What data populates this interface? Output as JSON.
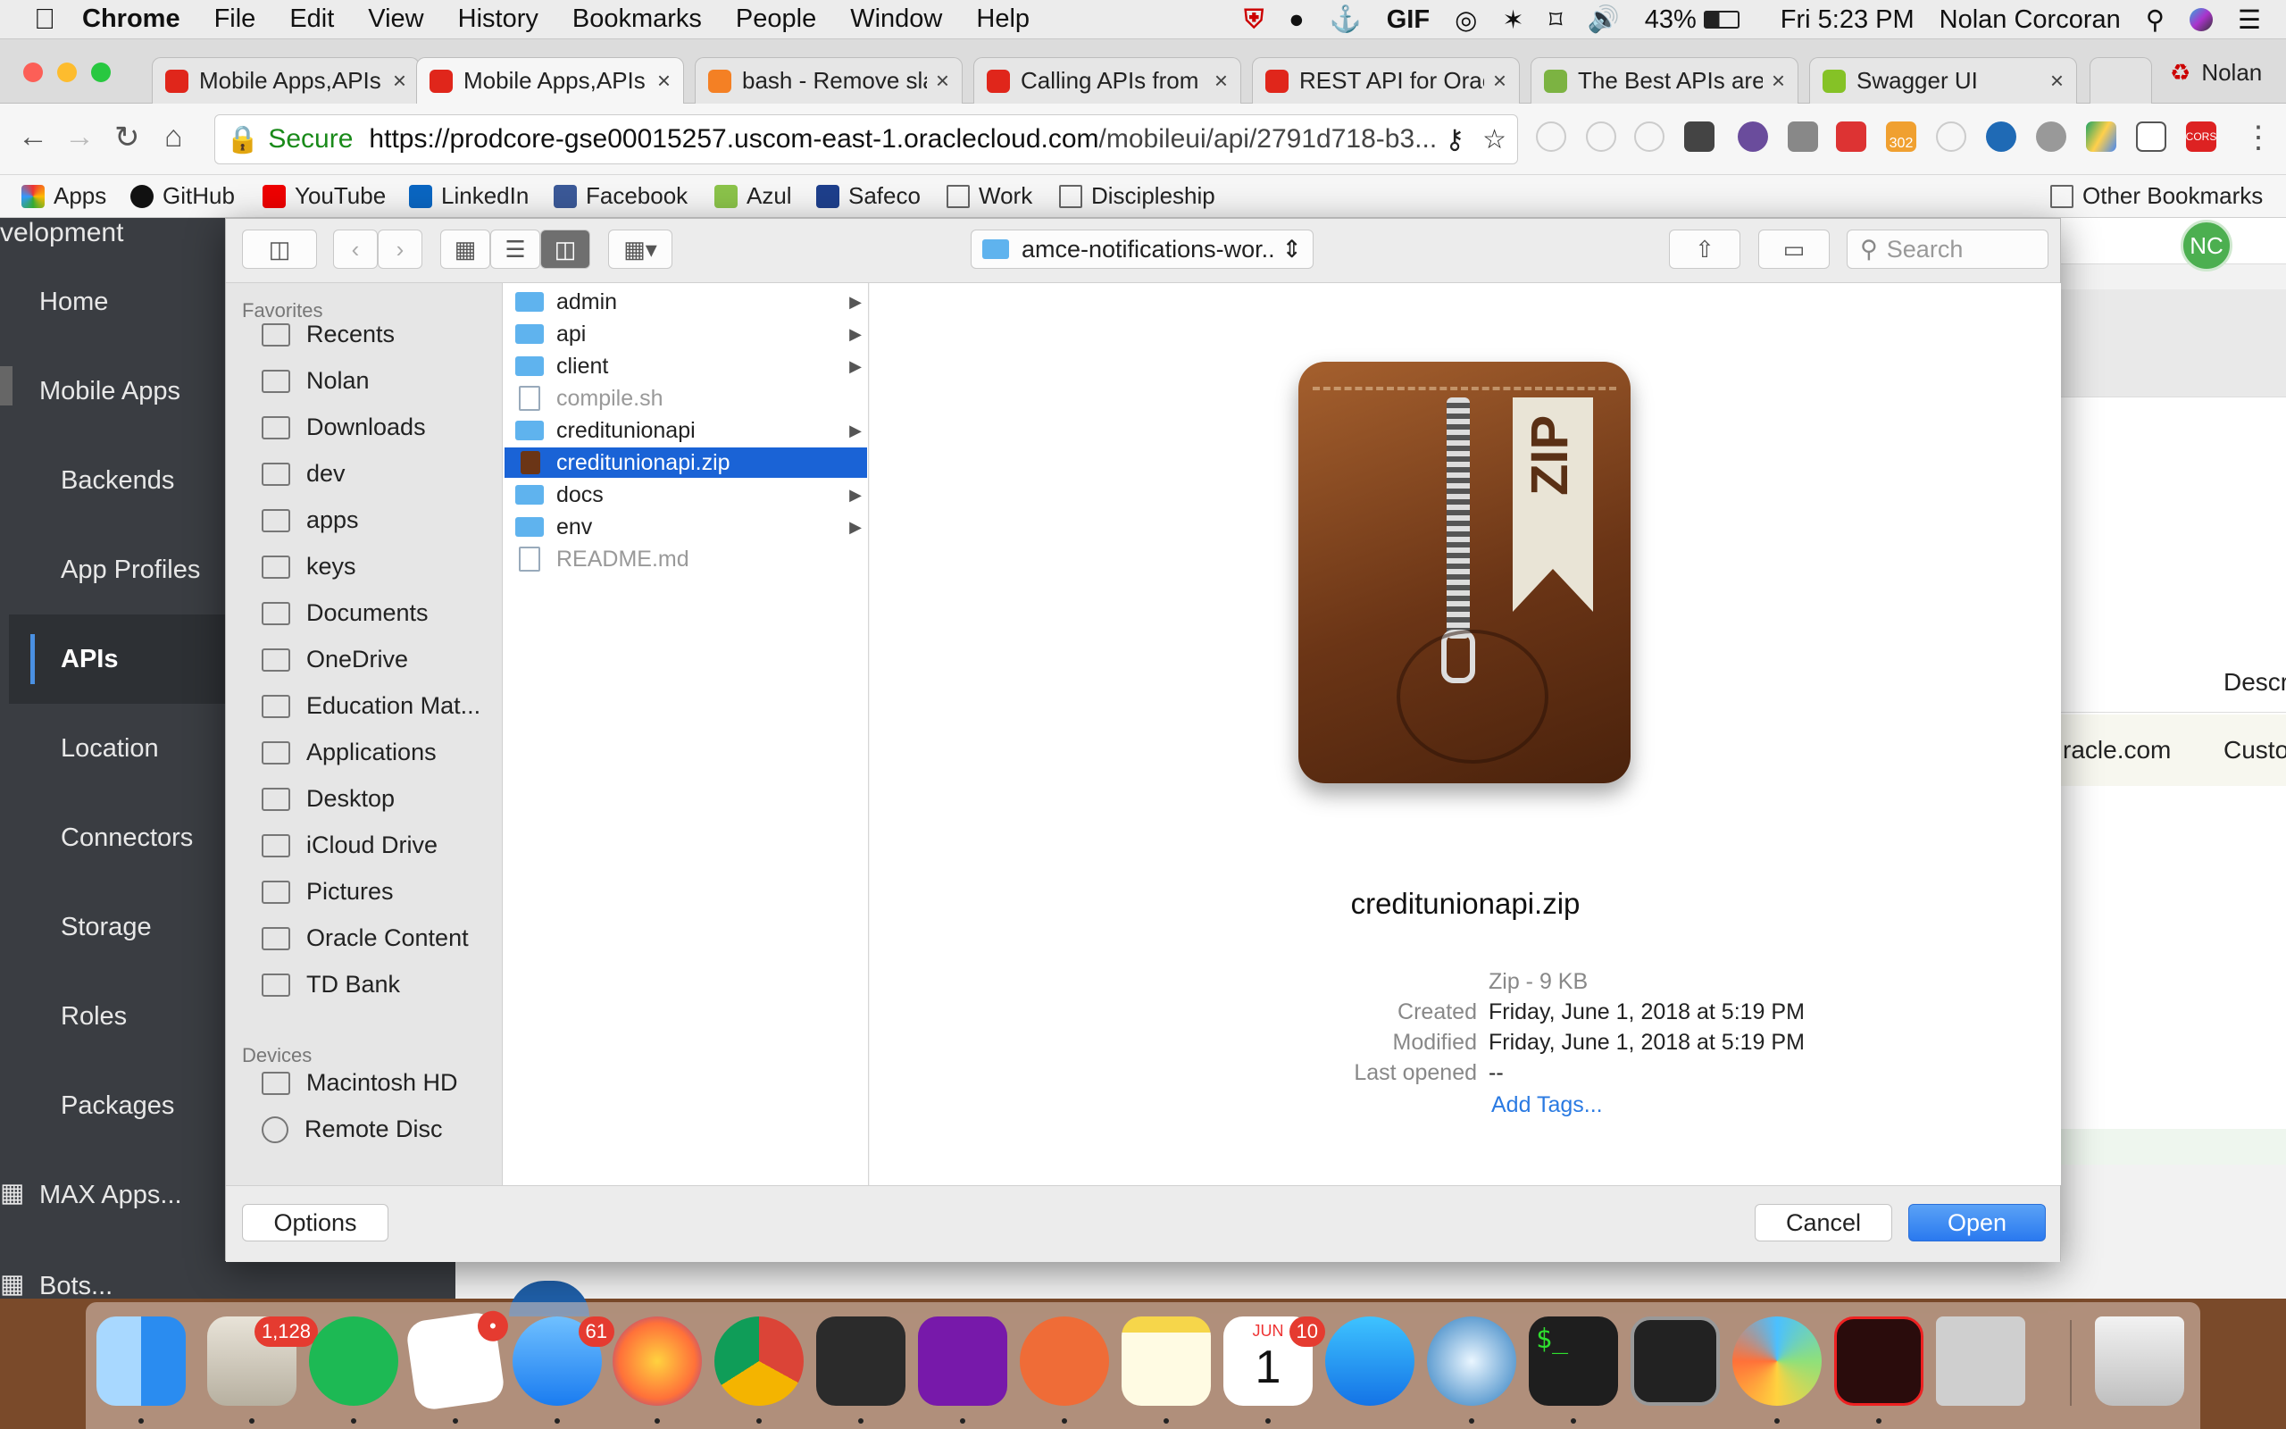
{
  "menubar": {
    "apple": "",
    "app": "Chrome",
    "items": [
      "File",
      "Edit",
      "View",
      "History",
      "Bookmarks",
      "People",
      "Window",
      "Help"
    ],
    "status": {
      "gif": "GIF",
      "battery": "43%",
      "clock": "Fri 5:23 PM",
      "user": "Nolan Corcoran"
    }
  },
  "tabs": [
    {
      "title": "Mobile Apps,APIs",
      "color": "#e0261b",
      "active": false
    },
    {
      "title": "Mobile Apps,APIs",
      "color": "#e0261b",
      "active": true
    },
    {
      "title": "bash - Remove sla",
      "color": "#f48024",
      "active": false
    },
    {
      "title": "Calling APIs from",
      "color": "#e0261b",
      "active": false
    },
    {
      "title": "REST API for Orac",
      "color": "#e0261b",
      "active": false
    },
    {
      "title": "The Best APIs are",
      "color": "#7cb342",
      "active": false
    },
    {
      "title": "Swagger UI",
      "color": "#85c226",
      "active": false
    }
  ],
  "profile": "Nolan",
  "toolbar": {
    "secure": "Secure",
    "url_host": "https://prodcore-gse00015257.uscom-east-1.oraclecloud.com",
    "url_path": "/mobileui/api/2791d718-b3...",
    "ext302": "302",
    "extCors": "CORS"
  },
  "bookmarks": {
    "items": [
      "Apps",
      "GitHub",
      "YouTube",
      "LinkedIn",
      "Facebook",
      "Azul",
      "Safeco",
      "Work",
      "Discipleship"
    ],
    "other": "Other Bookmarks"
  },
  "sidenav": {
    "header": "velopment",
    "items": [
      "Home",
      "Mobile Apps",
      "Backends",
      "App Profiles",
      "APIs",
      "Location",
      "Connectors",
      "Storage",
      "Roles",
      "Packages",
      "MAX Apps...",
      "Bots..."
    ],
    "active": "APIs"
  },
  "pagebg": {
    "avatar": "NC",
    "descr": "Descr",
    "email": "racle.com",
    "cust": "Custo"
  },
  "dialog": {
    "path": "amce-notifications-wor...",
    "search_placeholder": "Search",
    "favorites_label": "Favorites",
    "favorites": [
      "Recents",
      "Nolan",
      "Downloads",
      "dev",
      "apps",
      "keys",
      "Documents",
      "OneDrive",
      "Education Mat...",
      "Applications",
      "Desktop",
      "iCloud Drive",
      "Pictures",
      "Oracle Content",
      "TD Bank"
    ],
    "devices_label": "Devices",
    "devices": [
      "Macintosh HD",
      "Remote Disc"
    ],
    "files": [
      {
        "name": "admin",
        "kind": "folder",
        "state": "normal"
      },
      {
        "name": "api",
        "kind": "folder",
        "state": "normal"
      },
      {
        "name": "client",
        "kind": "folder",
        "state": "normal"
      },
      {
        "name": "compile.sh",
        "kind": "file",
        "state": "dim"
      },
      {
        "name": "creditunionapi",
        "kind": "folder",
        "state": "normal"
      },
      {
        "name": "creditunionapi.zip",
        "kind": "zip",
        "state": "selected"
      },
      {
        "name": "docs",
        "kind": "folder",
        "state": "normal"
      },
      {
        "name": "env",
        "kind": "folder",
        "state": "normal"
      },
      {
        "name": "README.md",
        "kind": "file",
        "state": "dim"
      }
    ],
    "preview": {
      "icon_label": "ZIP",
      "filename": "creditunionapi.zip",
      "kind": "Zip - 9 KB",
      "created_label": "Created",
      "created": "Friday, June 1, 2018 at 5:19 PM",
      "modified_label": "Modified",
      "modified": "Friday, June 1, 2018 at 5:19 PM",
      "opened_label": "Last opened",
      "opened": "--",
      "tags": "Add Tags..."
    },
    "options": "Options",
    "cancel": "Cancel",
    "open": "Open"
  },
  "dock": {
    "badges": {
      "mail": "1,128",
      "slack": "•",
      "messages": "61",
      "calendar": "10"
    },
    "calendar": {
      "month": "JUN",
      "day": "1"
    },
    "terminal": "$_"
  }
}
